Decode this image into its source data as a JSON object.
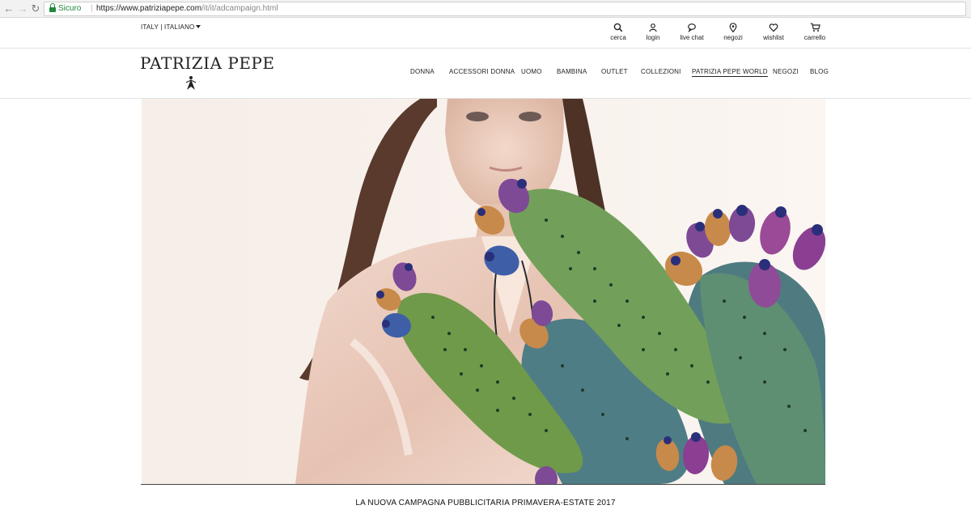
{
  "browser": {
    "secure_label": "Sicuro",
    "url_host": "https://www.patriziapepe.com",
    "url_path": "/it/it/adcampaign.html"
  },
  "util": {
    "locale": "ITALY  |  ITALIANO",
    "items": [
      {
        "label": "cerca",
        "icon": "search-icon"
      },
      {
        "label": "login",
        "icon": "user-icon"
      },
      {
        "label": "live chat",
        "icon": "chat-icon"
      },
      {
        "label": "negozi",
        "icon": "map-pin-icon"
      },
      {
        "label": "wishlist",
        "icon": "heart-icon"
      },
      {
        "label": "carrello",
        "icon": "cart-icon"
      }
    ]
  },
  "header": {
    "logo": "PATRIZIA PEPE",
    "nav": [
      {
        "label": "DONNA"
      },
      {
        "label": "ACCESSORI DONNA"
      },
      {
        "label": "UOMO"
      },
      {
        "label": "BAMBINA"
      },
      {
        "label": "OUTLET"
      },
      {
        "label": "COLLEZIONI"
      },
      {
        "label": "PATRIZIA PEPE WORLD"
      },
      {
        "label": "NEGOZI"
      },
      {
        "label": "BLOG"
      }
    ]
  },
  "hero": {
    "caption": "LA NUOVA CAMPAGNA PUBBLICITARIA PRIMAVERA-ESTATE 2017"
  },
  "colors": {
    "secure_green": "#1f8a3b",
    "text": "#222222",
    "cactus_green": "#6f9a4a",
    "cactus_teal": "#4f7d86",
    "fruit_purple": "#7e4a96"
  }
}
